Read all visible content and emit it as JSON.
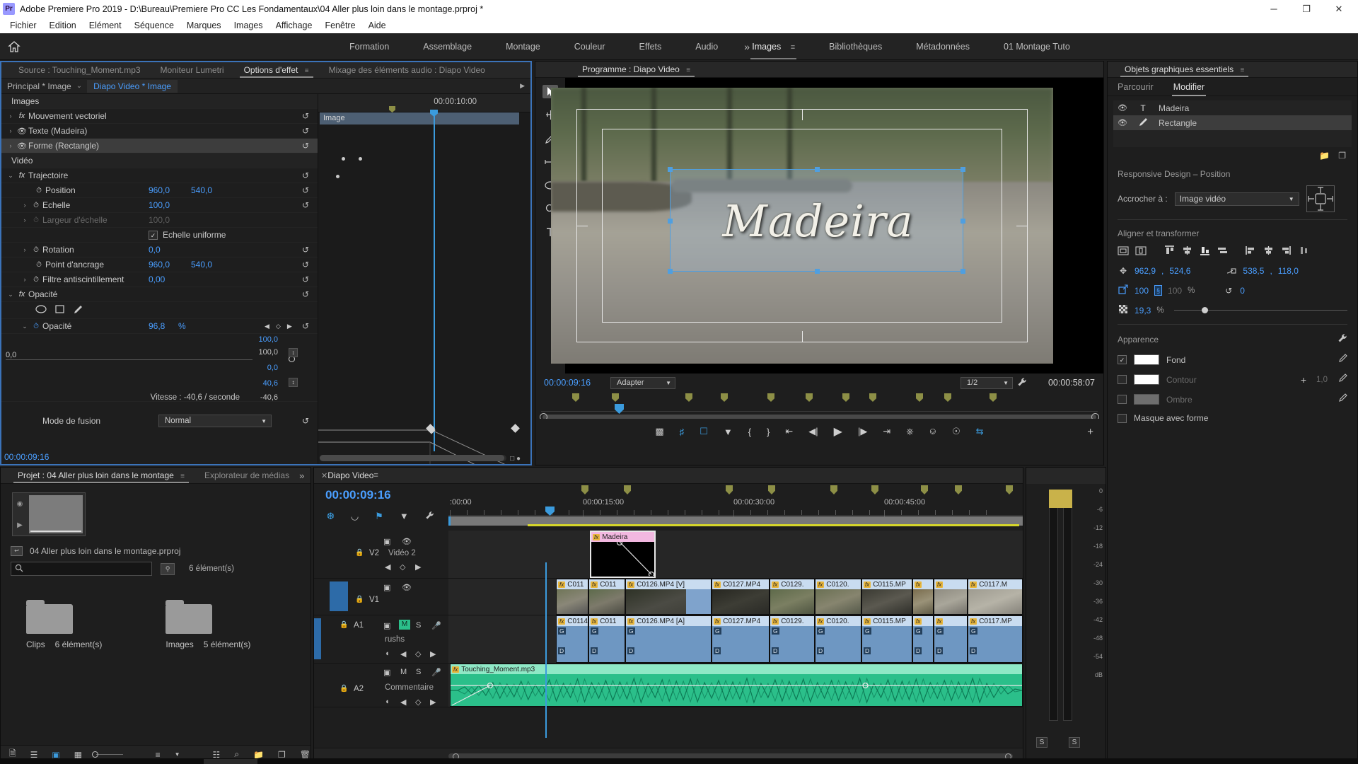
{
  "titlebar": {
    "app_logo": "Pr",
    "title": "Adobe Premiere Pro 2019 - D:\\Bureau\\Premiere Pro CC Les Fondamentaux\\04  Aller plus loin dans le montage.prproj *",
    "minimize": "─",
    "maximize": "❐",
    "close": "✕"
  },
  "menubar": {
    "items": [
      "Fichier",
      "Edition",
      "Elément",
      "Séquence",
      "Marques",
      "Images",
      "Affichage",
      "Fenêtre",
      "Aide"
    ]
  },
  "workspace": {
    "home_icon": "home-icon",
    "items": [
      "Formation",
      "Assemblage",
      "Montage",
      "Couleur",
      "Effets",
      "Audio",
      "Images",
      "Bibliothèques",
      "Métadonnées",
      "01 Montage Tuto"
    ],
    "active": "Images",
    "more": "»"
  },
  "effect_controls": {
    "tabs": [
      {
        "label": "Source : Touching_Moment.mp3",
        "active": false
      },
      {
        "label": "Moniteur Lumetri",
        "active": false
      },
      {
        "label": "Options d'effet",
        "active": true
      },
      {
        "label": "Mixage des éléments audio : Diapo Video",
        "active": false
      }
    ],
    "subheader": {
      "master": "Principal * Image",
      "chevron": "⌄",
      "sequence": "Diapo Video * Image",
      "arrow": "▶"
    },
    "group_images": "Images",
    "group_video": "Vidéo",
    "effects": [
      {
        "name": "Mouvement vectoriel",
        "icon": "fx",
        "twirl": "›"
      },
      {
        "name": "Texte (Madeira)",
        "icon": "eye",
        "twirl": "›"
      },
      {
        "name": "Forme (Rectangle)",
        "icon": "eye",
        "twirl": "›",
        "selected": true
      }
    ],
    "trajectoire": {
      "label": "Trajectoire",
      "twirl": "⌄"
    },
    "properties": [
      {
        "name": "Position",
        "v1": "960,0",
        "v2": "540,0",
        "twirl": "",
        "dim": false
      },
      {
        "name": "Echelle",
        "v1": "100,0",
        "v2": "",
        "twirl": "›",
        "dim": false
      },
      {
        "name": "Largeur d'échelle",
        "v1": "100,0",
        "v2": "",
        "twirl": "›",
        "dim": true
      },
      {
        "name": "Rotation",
        "v1": "0,0",
        "v2": "",
        "twirl": "›",
        "dim": false
      },
      {
        "name": "Point d'ancrage",
        "v1": "960,0",
        "v2": "540,0",
        "twirl": "",
        "dim": false
      },
      {
        "name": "Filtre antiscintillement",
        "v1": "0,00",
        "v2": "",
        "twirl": "›",
        "dim": false
      }
    ],
    "uniform_scale": {
      "label": "Echelle uniforme",
      "checked": true
    },
    "opacite_group": "Opacité",
    "mask_tools": [
      "ellipse-mask-icon",
      "rectangle-mask-icon",
      "pen-mask-icon"
    ],
    "opacite": {
      "name": "Opacité",
      "value": "96,8",
      "unit": "%",
      "twirl": "⌄"
    },
    "graph": {
      "max_label": "100,0",
      "min_label": "0,0",
      "value_top": "100,0",
      "slider_value": "100,0",
      "value_zero": "0,0",
      "value_neg": "40,6",
      "value_neg2": "-40,6"
    },
    "speed": {
      "label": "Vitesse : -40,6 / seconde"
    },
    "blend": {
      "label": "Mode de fusion",
      "value": "Normal",
      "chevron": "⌄"
    },
    "timecode": "00:00:09:16",
    "right_ruler": {
      "timecode": "00:00:10:00",
      "clip_label": "Image"
    },
    "reset_icon": "↺"
  },
  "program_monitor": {
    "tab": "Programme : Diapo Video",
    "burger": "≡",
    "tools": [
      "selection-tool-icon",
      "hand-tool-icon",
      "pen-tool-icon",
      "ruler-tool-icon",
      "ellipse-tool-icon",
      "zoom-tool-icon",
      "type-tool-icon"
    ],
    "title_text": "Madeira",
    "timecode_left": "00:00:09:16",
    "fit_select": {
      "value": "Adapter",
      "chevron": "⌄"
    },
    "quality_select": {
      "value": "1/2",
      "chevron": "⌄"
    },
    "wrench_icon": "wrench-icon",
    "timecode_right": "00:00:58:07",
    "transport": [
      "add-marker-icon",
      "mark-in-out-icon",
      "export-frame-icon",
      "marker-icon",
      "mark-in-icon",
      "mark-out-icon",
      "go-to-in-icon",
      "step-back-icon",
      "play-icon",
      "step-forward-icon",
      "go-to-out-icon",
      "lift-icon",
      "extract-icon",
      "camera-icon",
      "comparison-icon"
    ],
    "plus_icon": "+"
  },
  "essential_graphics": {
    "title": "Objets graphiques essentiels",
    "burger": "≡",
    "tabs": [
      {
        "label": "Parcourir",
        "active": false
      },
      {
        "label": "Modifier",
        "active": true
      }
    ],
    "layers": [
      {
        "name": "Madeira",
        "icon": "text-layer-icon",
        "visible": "◉",
        "selected": false
      },
      {
        "name": "Rectangle",
        "icon": "shape-layer-icon",
        "visible": "◉",
        "selected": true
      }
    ],
    "list_buttons": [
      "new-group-icon",
      "new-layer-icon"
    ],
    "responsive": {
      "title": "Responsive Design – Position",
      "pin_label": "Accrocher à :",
      "pin_value": "Image vidéo",
      "chevron": "⌄"
    },
    "align_title": "Aligner et transformer",
    "align_icons": [
      "align-h-center-video-icon",
      "align-v-center-video-icon",
      "align-top-icon",
      "align-v-center-icon",
      "align-bottom-icon",
      "distribute-v-icon",
      "align-left-icon",
      "align-h-center-icon",
      "align-right-icon",
      "distribute-h-icon"
    ],
    "transform": {
      "position_icon": "move-icon",
      "position_x": "962,9",
      "position_y": "524,6",
      "anchor_icon": "anchor-point-icon",
      "anchor_x": "538,5",
      "anchor_y": "118,0",
      "scale_icon": "scale-icon",
      "scale_w": "100",
      "scale_lock": "link-icon",
      "scale_h": "100",
      "scale_unit": "%",
      "rotation_icon": "rotation-icon",
      "rotation": "0",
      "opacity_icon": "opacity-icon",
      "opacity": "19,3",
      "opacity_unit": "%"
    },
    "appearance": {
      "title": "Apparence",
      "wrench": "wrench-icon",
      "rows": [
        {
          "label": "Fond",
          "checked": true,
          "color": "#ffffff",
          "dim": false
        },
        {
          "label": "Contour",
          "checked": false,
          "color": "#ffffff",
          "dim": true,
          "width": "1,0",
          "plus": "+"
        },
        {
          "label": "Ombre",
          "checked": false,
          "color": "#6e6e6e",
          "dim": true
        }
      ],
      "mask_label": "Masque avec forme",
      "mask_checked": false
    }
  },
  "project_panel": {
    "tabs": [
      {
        "label": "Projet : 04  Aller plus loin dans le montage",
        "active": true,
        "burger": "≡"
      },
      {
        "label": "Explorateur de médias",
        "active": false
      }
    ],
    "more": "»",
    "project_file": "04  Aller plus loin dans le montage.prproj",
    "search_placeholder": "",
    "item_count": "6 élément(s)",
    "bins": [
      {
        "name": "Clips",
        "count": "6 élément(s)"
      },
      {
        "name": "Images",
        "count": "5 élément(s)"
      }
    ],
    "bottom_icons": [
      "list-view-icon",
      "icon-view-icon",
      "freeform-view-icon",
      "zoom-slider",
      "sort-icon",
      "new-bin-icon",
      "new-item-icon",
      "delete-icon"
    ]
  },
  "timeline": {
    "close": "✕",
    "name": "Diapo Video",
    "burger": "≡",
    "timecode": "00:00:09:16",
    "tools": [
      "nest-icon",
      "snap-icon",
      "linked-selection-icon",
      "marker-icon",
      "settings-icon"
    ],
    "time_labels": [
      ":00:00",
      "00:00:15:00",
      "00:00:30:00",
      "00:00:45:00"
    ],
    "tracks": [
      {
        "id": "V2",
        "name": "Vidéo 2",
        "type": "video"
      },
      {
        "id": "V1",
        "name": "",
        "type": "video"
      },
      {
        "id": "A1",
        "name": "rushs",
        "type": "audio"
      },
      {
        "id": "A2",
        "name": "Commentaire",
        "type": "audio"
      }
    ],
    "v2_clip": {
      "label": "Madeira",
      "fx": "fx"
    },
    "v1_clips": [
      "C011",
      "C011",
      "C0126.MP4 [V]",
      "C0127.MP4",
      "C0129.",
      "C0120.",
      "C0115.MP",
      "",
      "",
      "C0117.M"
    ],
    "a1_clips": [
      "C0114.",
      "C011",
      "C0126.MP4 [A]",
      "C0127.MP4",
      "C0129.",
      "C0120.",
      "C0115.MP",
      "",
      "",
      "C0117.MP"
    ],
    "a2_clip": {
      "label": "Touching_Moment.mp3",
      "fx": "fx"
    }
  },
  "audio_meters": {
    "scale": [
      "0",
      "-6",
      "-12",
      "-18",
      "-24",
      "-30",
      "-36",
      "-42",
      "-48",
      "-54",
      "dB"
    ],
    "solo_buttons": [
      "S",
      "S"
    ]
  }
}
